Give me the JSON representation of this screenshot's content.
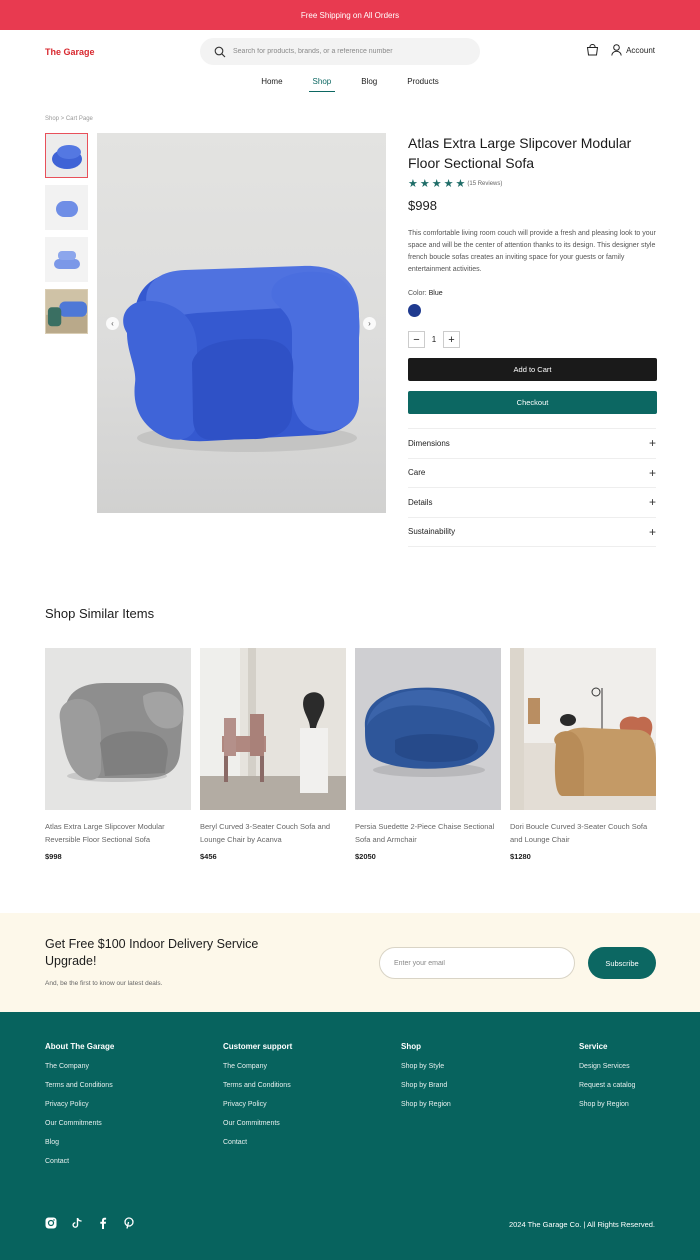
{
  "topbar": {
    "text": "Free Shipping on All Orders"
  },
  "header": {
    "logo": "The Garage",
    "search_placeholder": "Search for products, brands, or a reference number",
    "account_label": "Account",
    "nav": [
      "Home",
      "Shop",
      "Blog",
      "Products"
    ],
    "active_nav": "Shop"
  },
  "breadcrumb": "Shop > Cart Page",
  "product": {
    "title": "Atlas Extra Large Slipcover Modular Floor Sectional Sofa",
    "rating_stars": 5,
    "reviews": "(15 Reviews)",
    "price": "$998",
    "description": "This comfortable living room couch will provide a fresh and pleasing look to your space and will be the center of attention thanks to its design. This designer style french boucle sofas creates an inviting space for your guests or family entertainment activities.",
    "color_label": "Color:",
    "color_value": "Blue",
    "swatch_color": "#1f3a8f",
    "quantity": "1",
    "add_to_cart": "Add to Cart",
    "checkout": "Checkout",
    "accordion": [
      "Dimensions",
      "Care",
      "Details",
      "Sustainability"
    ]
  },
  "similar": {
    "title": "Shop Similar Items",
    "items": [
      {
        "name": "Atlas Extra Large Slipcover Modular Reversible Floor Sectional Sofa",
        "price": "$998"
      },
      {
        "name": "Beryl Curved 3-Seater Couch Sofa and Lounge Chair by Acanva",
        "price": "$456"
      },
      {
        "name": "Persia Suedette 2-Piece Chaise Sectional Sofa and Armchair",
        "price": "$2050"
      },
      {
        "name": "Dori Boucle Curved 3-Seater Couch Sofa and Lounge Chair",
        "price": "$1280"
      }
    ]
  },
  "newsletter": {
    "title": "Get Free $100 Indoor Delivery Service Upgrade!",
    "subtitle": "And, be the first to know our latest deals.",
    "placeholder": "Enter your email",
    "button": "Subscribe"
  },
  "footer": {
    "columns": [
      {
        "title": "About The Garage",
        "links": [
          "The Company",
          "Terms and Conditions",
          "Privacy Policy",
          "Our Commitments",
          "Blog",
          "Contact"
        ]
      },
      {
        "title": "Customer support",
        "links": [
          "The Company",
          "Terms and Conditions",
          "Privacy Policy",
          "Our Commitments",
          "Contact"
        ]
      },
      {
        "title": "Shop",
        "links": [
          "Shop by Style",
          "Shop by Brand",
          "Shop by Region"
        ]
      },
      {
        "title": "Service",
        "links": [
          "Design Services",
          "Request a catalog",
          "Shop by Region"
        ]
      }
    ],
    "social_icons": [
      "instagram-icon",
      "tiktok-icon",
      "facebook-icon",
      "pinterest-icon"
    ],
    "copyright": "2024 The Garage Co. | All Rights Reserved."
  },
  "colors": {
    "brand_red": "#e83a50",
    "accent_teal": "#0c6762",
    "footer_bg": "#07635e",
    "newsletter_bg": "#fdf8ea"
  }
}
